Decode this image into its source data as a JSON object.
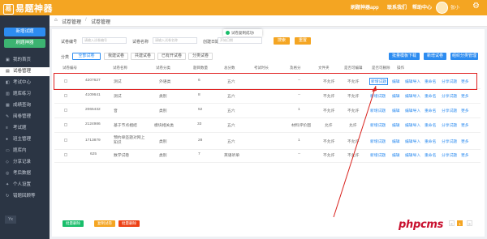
{
  "header": {
    "logo": "易题神器",
    "nav": [
      "刷题神器app",
      "联系我们",
      "帮助中心"
    ],
    "username": "张小",
    "gear_icon": "gear-icon",
    "avatar_icon": "user-avatar"
  },
  "sidebar": {
    "btn_primary": "新增试题",
    "btn_secondary": "刷题神器",
    "items": [
      {
        "label": "我的首页",
        "icon": "home-icon"
      },
      {
        "label": "试卷管理",
        "icon": "doc-icon"
      },
      {
        "label": "考试中心",
        "icon": "exam-icon"
      },
      {
        "label": "题库练习",
        "icon": "book-icon"
      },
      {
        "label": "成绩查询",
        "icon": "chart-icon"
      },
      {
        "label": "阅卷管理",
        "icon": "pen-icon"
      },
      {
        "label": "考试题",
        "icon": "list-icon"
      },
      {
        "label": "班主管理",
        "icon": "user-icon"
      },
      {
        "label": "题库内",
        "icon": "folder-icon"
      },
      {
        "label": "分享记录",
        "icon": "share-icon"
      },
      {
        "label": "考后数据",
        "icon": "data-icon"
      },
      {
        "label": "个人设置",
        "icon": "setting-icon"
      },
      {
        "label": "错题回顾等",
        "icon": "retry-icon"
      }
    ],
    "active_index": 1,
    "footer": "Yx"
  },
  "breadcrumb": {
    "home_icon": "home-icon",
    "items": [
      "试卷管理",
      "试卷管理"
    ],
    "sep": "/"
  },
  "filters": {
    "name_label": "试卷编号",
    "name_placeholder": "请输入试卷编号",
    "type_label": "试卷名称",
    "type_placeholder": "请输入试卷名称",
    "date_label": "创建日期范围",
    "date_placeholder": "开始日期",
    "search_btn": "搜索",
    "reset_btn": "重置"
  },
  "toast": {
    "text": "试卷复制成功!",
    "icon": "success-icon"
  },
  "tabs": {
    "label": "分类",
    "items": [
      "全部试卷",
      "我建试卷",
      "共建试卷",
      "已有开试卷",
      "分类试卷"
    ],
    "selected": 0
  },
  "actions": [
    "批量模板下载",
    "新增试卷",
    "组织分类管理"
  ],
  "table": {
    "headers": [
      "试卷编号",
      "试卷名称",
      "试卷分类",
      "题目数量",
      "总分数",
      "考试时长",
      "及格分",
      "文件夹",
      "是否可编辑",
      "是否可删除",
      "操作"
    ],
    "rows": [
      {
        "id": "4207627",
        "name": "测试",
        "cat": "外语类",
        "count": "6",
        "score": "五六",
        "dur": "",
        "pass": "",
        "folder": "--",
        "editable": "不允许",
        "deletable": "不允许"
      },
      {
        "id": "4109641",
        "name": "测试",
        "cat": "类别",
        "count": "8",
        "score": "五六",
        "dur": "",
        "pass": "",
        "folder": "--",
        "editable": "不允许",
        "deletable": "不允许"
      },
      {
        "id": "2065432",
        "name": "音",
        "cat": "类别",
        "count": "52",
        "score": "五六",
        "dur": "",
        "pass": "",
        "folder": "1",
        "editable": "不允许",
        "deletable": "不允许"
      },
      {
        "id": "2124986",
        "name": "基于节点相结",
        "cat": "模块相关类",
        "count": "33",
        "score": "五六",
        "dur": "",
        "pass": "",
        "folder": "材料评价图",
        "editable": "允许",
        "deletable": "允许"
      },
      {
        "id": "1713879",
        "name": "预约单签题对网上知识",
        "cat": "类别",
        "count": "28",
        "score": "五六",
        "dur": "",
        "pass": "",
        "folder": "1",
        "editable": "不允许",
        "deletable": "不允许"
      },
      {
        "id": "625",
        "name": "数学试卷",
        "cat": "类别",
        "count": "7",
        "score": "英语听单",
        "dur": "",
        "pass": "",
        "folder": "--",
        "editable": "不允许",
        "deletable": "不允许"
      }
    ],
    "row_actions": [
      "新增试题",
      "编辑",
      "编辑导入",
      "重命名",
      "分享试题",
      "更多"
    ]
  },
  "footer": {
    "btns": [
      "批量删除",
      "复制试卷",
      "批量删除"
    ],
    "pages": [
      "<",
      "1",
      ">"
    ],
    "current_page": "1"
  },
  "watermark": "phpcms"
}
